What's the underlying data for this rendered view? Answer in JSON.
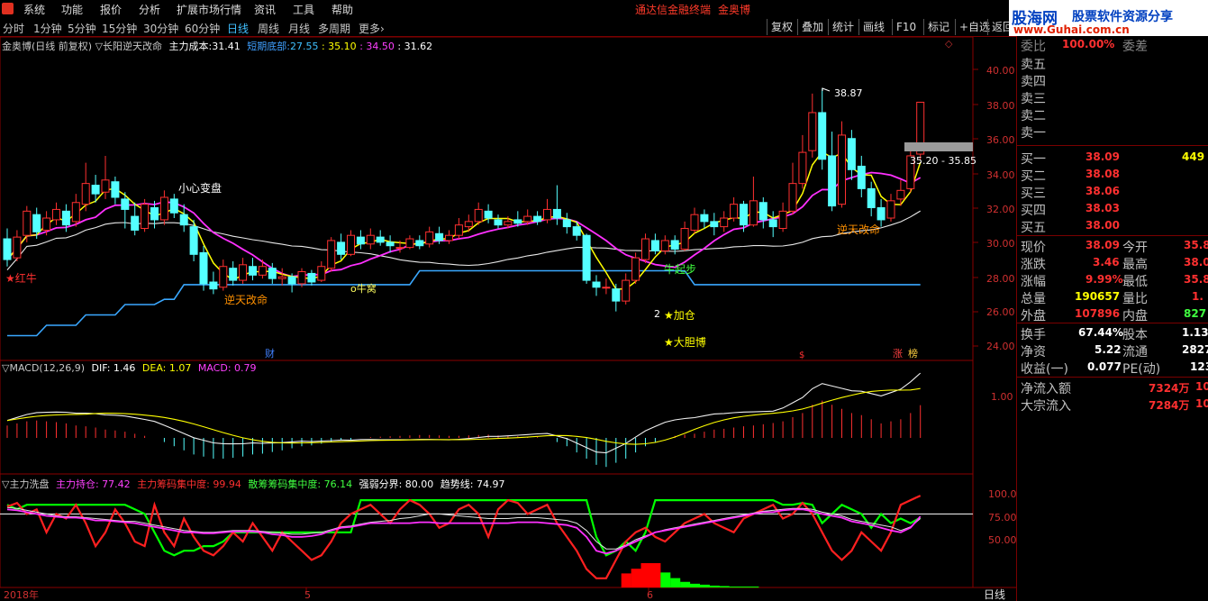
{
  "menu": [
    "系统",
    "功能",
    "报价",
    "分析",
    "扩展市场行情",
    "资讯",
    "工具",
    "帮助"
  ],
  "app_title": "通达信金融终端",
  "stock_name_title": "金奥博",
  "periods": [
    "分时",
    "1分钟",
    "5分钟",
    "15分钟",
    "30分钟",
    "60分钟",
    "日线",
    "周线",
    "月线",
    "多周期",
    "更多"
  ],
  "active_period": "日线",
  "toolbar": [
    "复权",
    "叠加",
    "统计",
    "画线",
    "F10",
    "标记",
    "+自选",
    "返回"
  ],
  "watermark": {
    "line1": "股海网",
    "line2": "股票软件资源分享",
    "line3": "www.Guhai.com.cn"
  },
  "main_legend": {
    "prefix": "金奥博(日线 前复权) ▽长阳逆天改命",
    "cost_label": "主力成本:",
    "cost_value": "31.41",
    "short_label": "短期底部:",
    "v1": "27.55",
    "v2": ": 35.10",
    "v3": ": 34.50",
    "v4": ": 31.62"
  },
  "macd_legend": {
    "name": "▽MACD(12,26,9)",
    "dif": "DIF: 1.46",
    "dea": "DEA: 1.07",
    "macd": "MACD: 0.79"
  },
  "wash_legend": {
    "name": "▽主力洗盘",
    "hold": "主力持仓: 77.42",
    "conc": "主力筹码集中度: 99.94",
    "retail": "散筹筹码集中度: 76.14",
    "strong": "强弱分界: 80.00",
    "trend": "趋势线: 74.97"
  },
  "price_axis": [
    "40.00",
    "38.00",
    "36.00",
    "34.00",
    "32.00",
    "30.00",
    "28.00",
    "26.00",
    "24.00"
  ],
  "macd_axis": [
    "1.00"
  ],
  "wash_axis": [
    "100.0",
    "75.00",
    "50.00"
  ],
  "date_axis": [
    "2018年",
    "5",
    "6"
  ],
  "axis_mode": "日线",
  "annotations": {
    "hongniu": "★红牛",
    "xiaoxin": "小心变盘",
    "nitian1": "逆天改命",
    "niuwo": "o牛窝",
    "jiacang": "★加仓",
    "dadanbo": "★大胆博",
    "niuqibu": "牛起步",
    "nitian2": "逆天改命",
    "high": "38.87",
    "range": "35.20 - 35.85",
    "cai": "财",
    "zhang": "涨",
    "bang": "榜",
    "s_mark": "$",
    "low_mark": "2"
  },
  "chart_data": {
    "type": "candlestick",
    "price_ylim": [
      23,
      41
    ],
    "candles": [
      [
        30.2,
        29.0,
        30.8,
        28.6
      ],
      [
        29.1,
        30.3,
        30.7,
        28.9
      ],
      [
        30.4,
        31.8,
        32.1,
        30.0
      ],
      [
        31.6,
        30.6,
        32.0,
        30.2
      ],
      [
        30.7,
        31.4,
        31.8,
        30.4
      ],
      [
        31.3,
        31.9,
        32.3,
        31.0
      ],
      [
        31.8,
        31.0,
        32.2,
        30.6
      ],
      [
        31.2,
        32.3,
        32.8,
        30.9
      ],
      [
        32.2,
        33.4,
        34.6,
        31.8
      ],
      [
        33.3,
        32.8,
        33.9,
        32.3
      ],
      [
        32.9,
        33.6,
        35.0,
        32.5
      ],
      [
        33.5,
        32.6,
        33.8,
        32.2
      ],
      [
        32.5,
        31.9,
        32.9,
        30.8
      ],
      [
        31.5,
        30.7,
        32.3,
        30.4
      ],
      [
        30.8,
        32.2,
        32.5,
        30.6
      ],
      [
        32.0,
        31.3,
        32.4,
        30.8
      ],
      [
        31.3,
        32.6,
        33.0,
        31.0
      ],
      [
        32.5,
        31.7,
        32.8,
        31.4
      ],
      [
        31.6,
        31.0,
        32.2,
        30.6
      ],
      [
        30.9,
        29.3,
        31.3,
        28.9
      ],
      [
        29.4,
        27.6,
        29.8,
        27.2
      ],
      [
        27.7,
        27.3,
        28.3,
        27.0
      ],
      [
        27.4,
        28.6,
        29.0,
        27.2
      ],
      [
        28.5,
        27.8,
        28.9,
        27.5
      ],
      [
        27.8,
        28.7,
        29.1,
        27.6
      ],
      [
        28.6,
        28.1,
        29.1,
        27.8
      ],
      [
        28.1,
        28.6,
        29.0,
        27.9
      ],
      [
        28.5,
        27.9,
        28.8,
        27.6
      ],
      [
        27.9,
        28.0,
        28.5,
        27.5
      ],
      [
        28.0,
        27.6,
        28.2,
        27.1
      ],
      [
        27.6,
        28.3,
        28.5,
        27.4
      ],
      [
        28.2,
        27.7,
        28.4,
        27.5
      ],
      [
        27.8,
        28.6,
        28.9,
        27.7
      ],
      [
        28.5,
        30.1,
        30.3,
        28.3
      ],
      [
        30.0,
        29.3,
        30.5,
        29.0
      ],
      [
        29.3,
        30.4,
        30.7,
        29.2
      ],
      [
        30.3,
        29.9,
        30.7,
        29.6
      ],
      [
        29.9,
        30.4,
        30.8,
        29.6
      ],
      [
        30.3,
        30.0,
        30.7,
        29.8
      ],
      [
        30.0,
        29.8,
        30.4,
        29.4
      ],
      [
        29.7,
        29.7,
        30.1,
        29.4
      ],
      [
        29.7,
        30.2,
        30.4,
        29.6
      ],
      [
        30.1,
        29.8,
        30.4,
        29.6
      ],
      [
        29.9,
        30.6,
        30.9,
        29.7
      ],
      [
        30.5,
        30.1,
        30.9,
        29.9
      ],
      [
        30.1,
        30.4,
        30.7,
        29.9
      ],
      [
        30.4,
        31.0,
        31.4,
        30.2
      ],
      [
        30.9,
        31.2,
        31.6,
        30.6
      ],
      [
        31.2,
        31.9,
        32.3,
        31.0
      ],
      [
        31.8,
        31.4,
        32.2,
        31.1
      ],
      [
        31.3,
        31.0,
        31.6,
        30.8
      ],
      [
        31.0,
        31.2,
        31.5,
        30.8
      ],
      [
        31.3,
        31.1,
        31.8,
        30.9
      ],
      [
        31.2,
        31.5,
        31.9,
        31.0
      ],
      [
        31.5,
        31.2,
        31.8,
        31.0
      ],
      [
        31.3,
        31.9,
        32.5,
        31.1
      ],
      [
        31.9,
        31.4,
        33.3,
        31.0
      ],
      [
        31.3,
        30.9,
        31.7,
        30.5
      ],
      [
        30.9,
        30.4,
        31.2,
        30.1
      ],
      [
        30.4,
        27.8,
        30.5,
        27.6
      ],
      [
        27.7,
        27.4,
        28.1,
        26.9
      ],
      [
        27.4,
        27.4,
        27.9,
        27.0
      ],
      [
        27.3,
        26.6,
        27.6,
        26.0
      ],
      [
        26.6,
        27.8,
        28.2,
        26.4
      ],
      [
        27.8,
        29.1,
        29.4,
        27.6
      ],
      [
        29.0,
        30.2,
        30.5,
        28.8
      ],
      [
        30.1,
        29.5,
        30.5,
        29.3
      ],
      [
        29.5,
        30.1,
        30.4,
        29.3
      ],
      [
        30.1,
        29.6,
        30.4,
        29.3
      ],
      [
        29.6,
        30.8,
        31.2,
        29.5
      ],
      [
        30.7,
        31.6,
        32.0,
        30.5
      ],
      [
        31.6,
        31.2,
        31.9,
        30.8
      ],
      [
        31.2,
        30.9,
        31.7,
        30.4
      ],
      [
        30.9,
        31.4,
        31.8,
        30.6
      ],
      [
        31.4,
        32.2,
        32.6,
        31.2
      ],
      [
        32.2,
        31.0,
        32.4,
        30.6
      ],
      [
        31.0,
        32.4,
        33.8,
        30.9
      ],
      [
        32.3,
        31.3,
        32.6,
        30.8
      ],
      [
        31.3,
        30.9,
        31.8,
        30.3
      ],
      [
        30.8,
        31.8,
        32.3,
        30.6
      ],
      [
        31.8,
        33.4,
        34.6,
        31.6
      ],
      [
        33.4,
        35.2,
        36.2,
        33.1
      ],
      [
        35.3,
        37.5,
        38.6,
        34.9
      ],
      [
        37.5,
        34.8,
        38.9,
        34.2
      ],
      [
        35.0,
        32.1,
        36.4,
        31.8
      ],
      [
        32.2,
        36.2,
        37.0,
        32.0
      ],
      [
        36.0,
        34.2,
        36.5,
        33.6
      ],
      [
        34.4,
        33.1,
        35.0,
        32.6
      ],
      [
        33.1,
        32.0,
        33.5,
        31.5
      ],
      [
        32.0,
        31.3,
        32.5,
        30.9
      ],
      [
        31.4,
        32.4,
        32.8,
        31.2
      ],
      [
        32.5,
        33.0,
        33.6,
        32.1
      ],
      [
        33.1,
        35.0,
        35.5,
        32.9
      ],
      [
        35.1,
        38.1,
        38.1,
        34.8
      ]
    ]
  }
}
